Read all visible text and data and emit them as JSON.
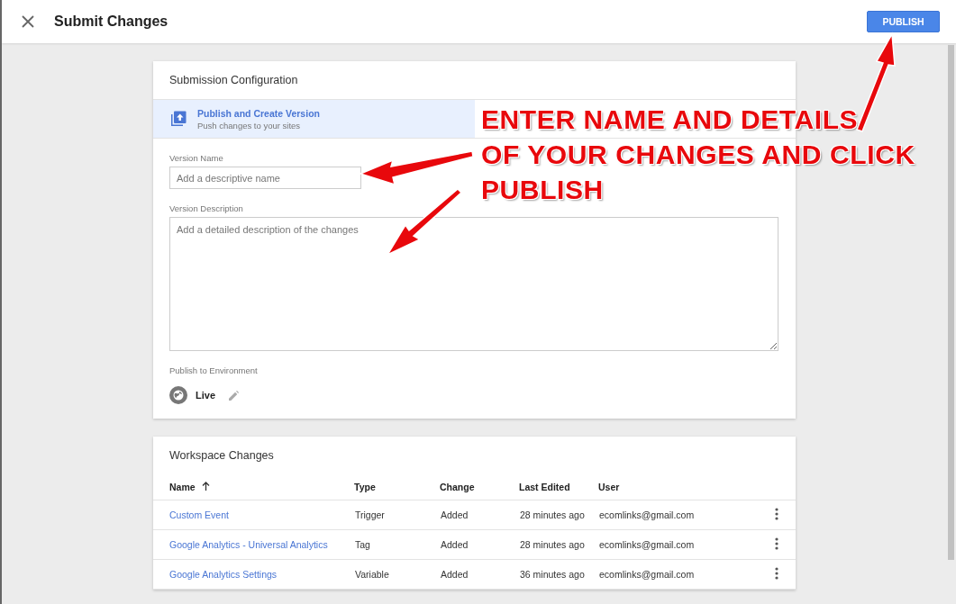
{
  "header": {
    "title": "Submit Changes",
    "publish_button": "PUBLISH"
  },
  "configuration": {
    "title": "Submission Configuration",
    "options": [
      {
        "title": "Publish and Create Version",
        "subtitle": "Push changes to your sites",
        "selected": true
      }
    ],
    "version_name": {
      "label": "Version Name",
      "placeholder": "Add a descriptive name"
    },
    "version_description": {
      "label": "Version Description",
      "placeholder": "Add a detailed description of the changes"
    },
    "environment": {
      "label": "Publish to Environment",
      "value": "Live"
    }
  },
  "workspace_changes": {
    "title": "Workspace Changes",
    "columns": [
      "Name",
      "Type",
      "Change",
      "Last Edited",
      "User"
    ],
    "rows": [
      {
        "name": "Custom Event",
        "type": "Trigger",
        "change": "Added",
        "last_edited": "28 minutes ago",
        "user": "ecomlinks@gmail.com"
      },
      {
        "name": "Google Analytics - Universal Analytics",
        "type": "Tag",
        "change": "Added",
        "last_edited": "28 minutes ago",
        "user": "ecomlinks@gmail.com"
      },
      {
        "name": "Google Analytics Settings",
        "type": "Variable",
        "change": "Added",
        "last_edited": "36 minutes ago",
        "user": "ecomlinks@gmail.com"
      }
    ]
  },
  "annotation": {
    "lines": [
      "ENTER NAME AND DETAILS",
      "OF YOUR CHANGES AND CLICK",
      "PUBLISH"
    ]
  }
}
